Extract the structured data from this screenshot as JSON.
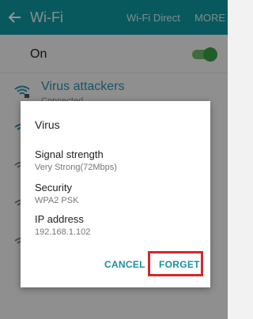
{
  "appbar": {
    "title": "Wi-Fi",
    "wifi_direct": "Wi-Fi Direct",
    "more": "MORE",
    "color": "#0e9aa0"
  },
  "toggle_row": {
    "label": "On",
    "enabled": true
  },
  "networks": [
    {
      "name": "Virus attackers",
      "status": "Connected",
      "secured": true
    },
    {
      "name": "",
      "status": ""
    },
    {
      "name": "",
      "status": ""
    },
    {
      "name": "",
      "status": ""
    },
    {
      "name": "",
      "status": ""
    }
  ],
  "dialog": {
    "title": "Virus",
    "signal_label": "Signal strength",
    "signal_value": "Very Strong(72Mbps)",
    "security_label": "Security",
    "security_value": "WPA2 PSK",
    "ip_label": "IP address",
    "ip_value": "192.168.1.102",
    "cancel": "CANCEL",
    "forget": "FORGET",
    "highlight_color": "#d22a2a"
  }
}
